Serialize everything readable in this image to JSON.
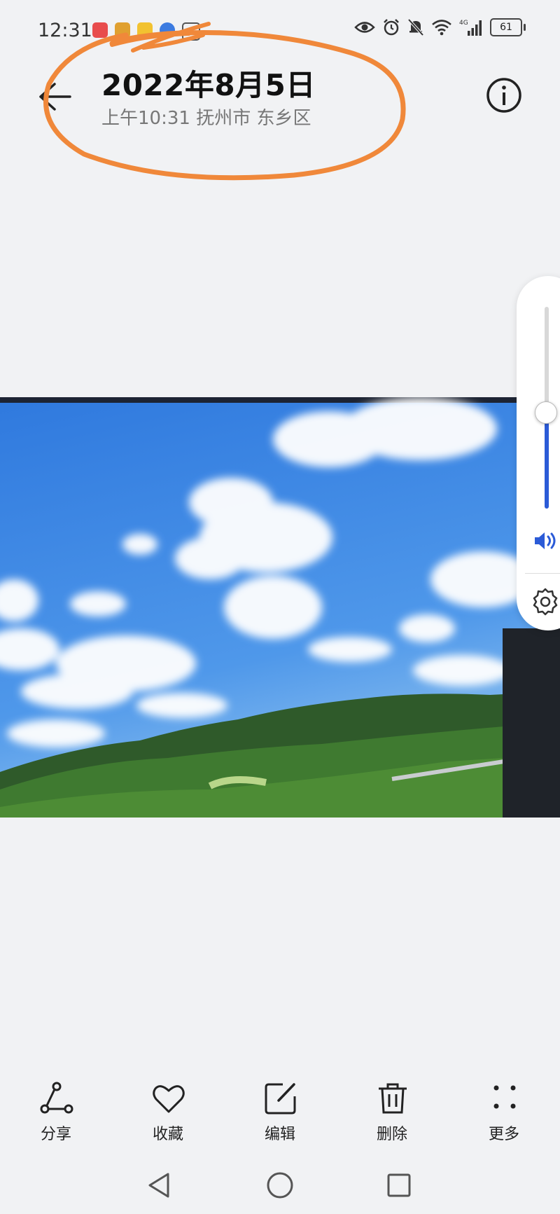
{
  "status_bar": {
    "time": "12:31",
    "battery": "61",
    "network": "4G"
  },
  "header": {
    "back_icon": "arrow-left-icon",
    "date": "2022年8月5日",
    "subtitle": "上午10:31 抚州市 东乡区",
    "info_icon": "info-icon"
  },
  "volume": {
    "level": 0.48,
    "accent": "#2b5bd7"
  },
  "toolbar": {
    "items": [
      {
        "label": "分享",
        "icon": "share-icon"
      },
      {
        "label": "收藏",
        "icon": "heart-icon"
      },
      {
        "label": "编辑",
        "icon": "edit-icon"
      },
      {
        "label": "删除",
        "icon": "trash-icon"
      },
      {
        "label": "更多",
        "icon": "more-icon"
      }
    ]
  },
  "colors": {
    "background": "#f1f2f4",
    "annotation": "#f0883a",
    "sky": "#3b82e0"
  }
}
